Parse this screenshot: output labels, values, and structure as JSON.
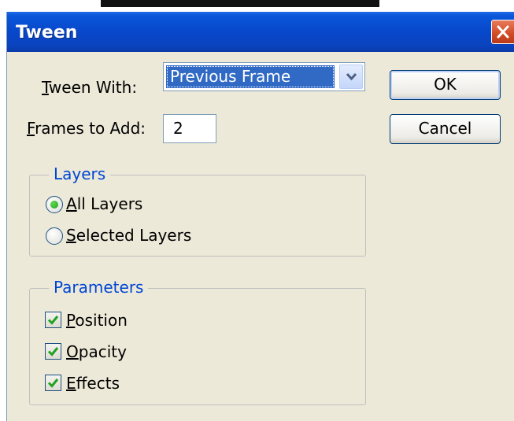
{
  "dialog": {
    "title": "Tween",
    "tween_with": {
      "label_u": "T",
      "label_rest": "ween With:",
      "value": "Previous Frame"
    },
    "frames_to_add": {
      "label_u": "F",
      "label_rest": "rames to Add:",
      "value": "2"
    },
    "buttons": {
      "ok": "OK",
      "cancel": "Cancel"
    },
    "layers": {
      "title": "Layers",
      "options": [
        {
          "u": "A",
          "rest": "ll Layers",
          "selected": true
        },
        {
          "u": "S",
          "rest": "elected Layers",
          "selected": false
        }
      ]
    },
    "parameters": {
      "title": "Parameters",
      "items": [
        {
          "u": "P",
          "rest": "osition",
          "checked": true
        },
        {
          "u": "O",
          "rest": "pacity",
          "checked": true
        },
        {
          "u": "E",
          "rest": "ffects",
          "checked": true
        }
      ]
    }
  },
  "icons": {
    "close": "close-icon",
    "dropdown": "chevron-down-icon",
    "check": "checkmark-icon"
  },
  "colors": {
    "titlebar": "#0846c9",
    "group_title": "#0046d5",
    "window_bg": "#ece9d8",
    "selection": "#316ac5"
  }
}
